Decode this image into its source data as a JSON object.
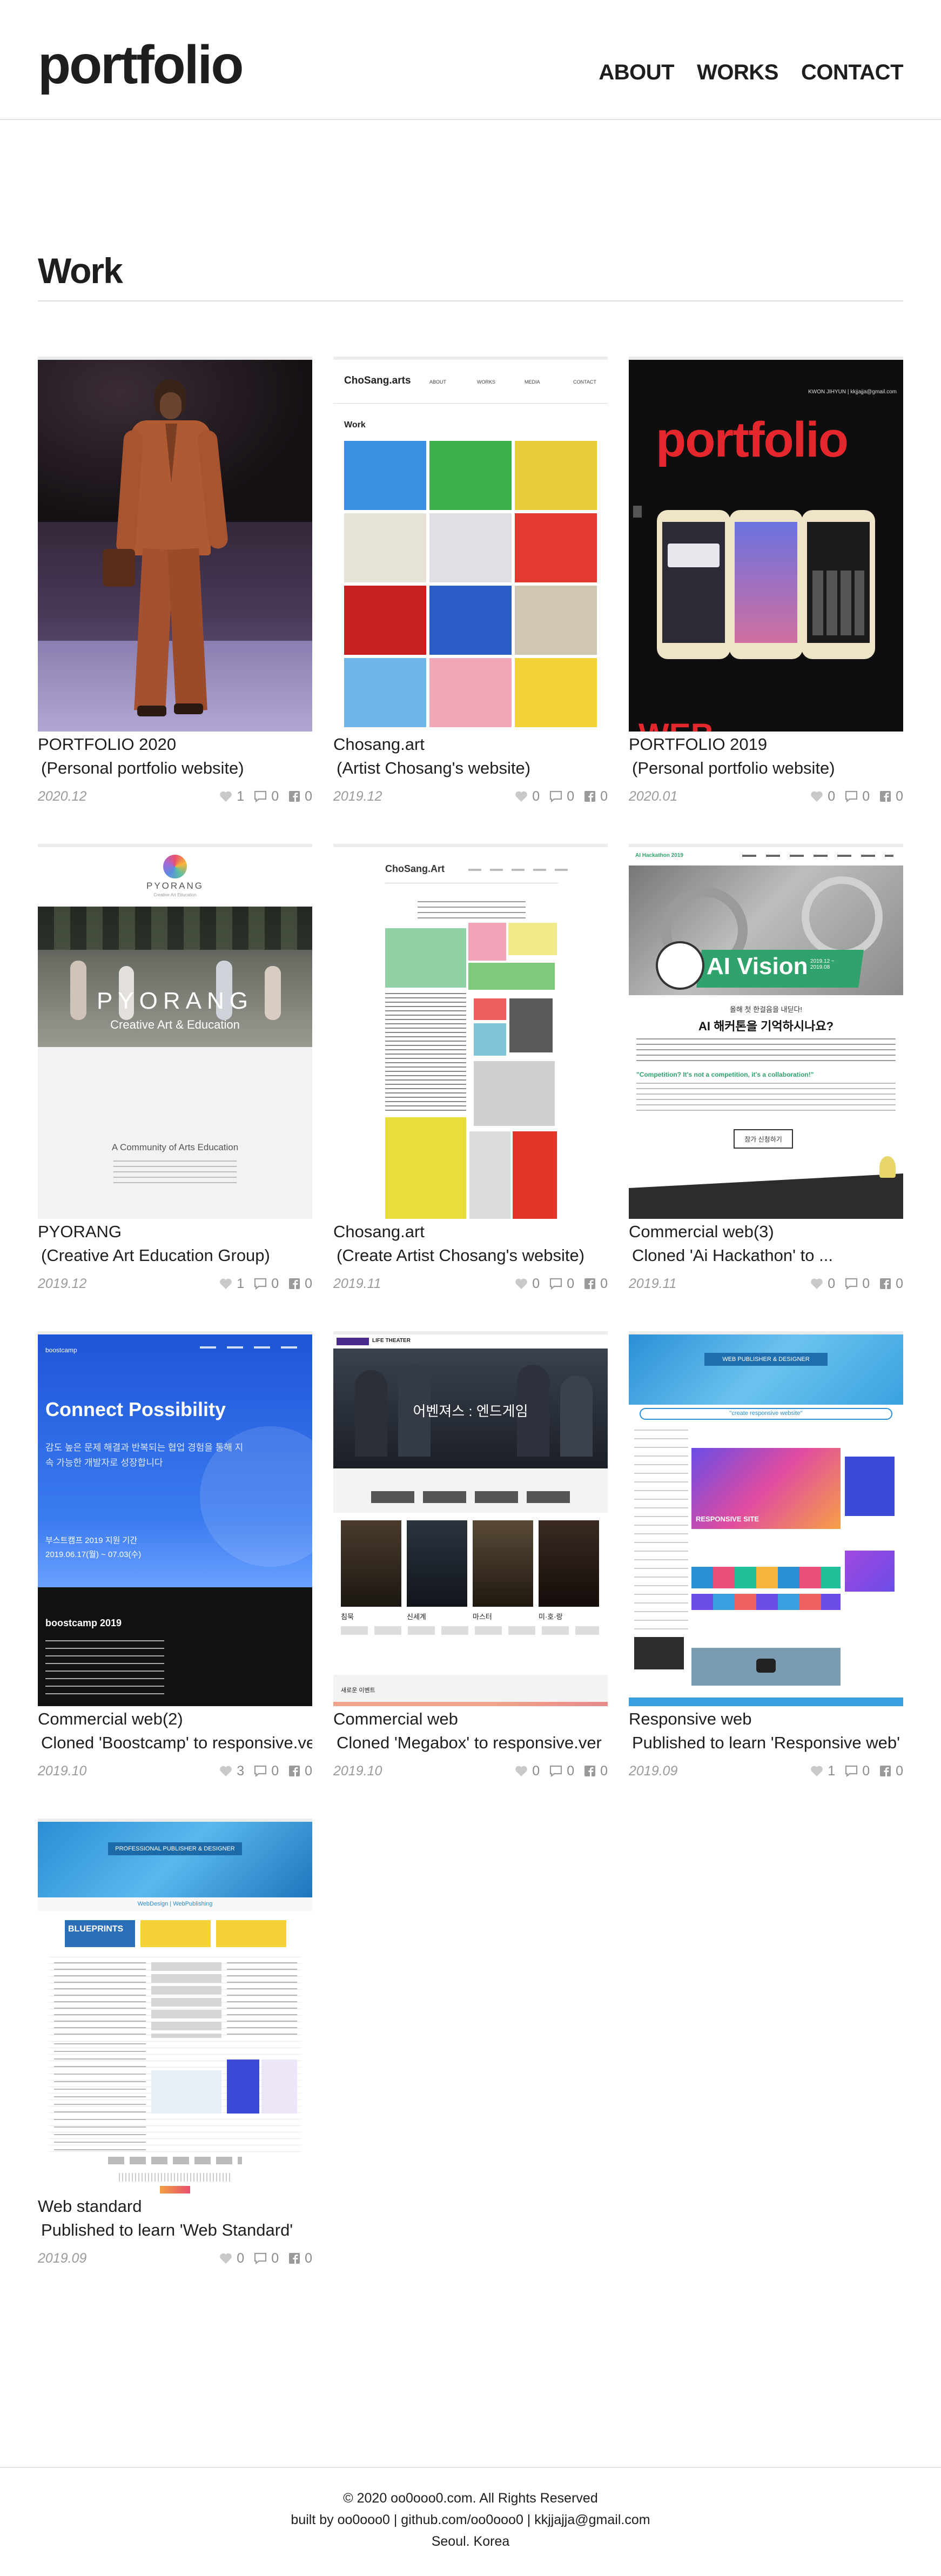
{
  "header": {
    "logo": "portfolio",
    "nav": [
      "ABOUT",
      "WORKS",
      "CONTACT"
    ]
  },
  "section": {
    "title": "Work"
  },
  "cards": [
    {
      "title": "PORTFOLIO 2020",
      "subtitle": "(Personal portfolio website)",
      "date": "2020.12",
      "likes": "1",
      "comments": "0",
      "shares": "0"
    },
    {
      "title": "Chosang.art",
      "subtitle": "(Artist Chosang's website)",
      "date": "2019.12",
      "likes": "0",
      "comments": "0",
      "shares": "0"
    },
    {
      "title": "PORTFOLIO 2019",
      "subtitle": "(Personal portfolio website)",
      "date": "2020.01",
      "likes": "0",
      "comments": "0",
      "shares": "0"
    },
    {
      "title": "PYORANG",
      "subtitle": "(Creative Art Education Group)",
      "date": "2019.12",
      "likes": "1",
      "comments": "0",
      "shares": "0"
    },
    {
      "title": "Chosang.art",
      "subtitle": "(Create Artist Chosang's website)",
      "date": "2019.11",
      "likes": "0",
      "comments": "0",
      "shares": "0"
    },
    {
      "title": "Commercial web(3)",
      "subtitle": "Cloned 'Ai Hackathon' to ...",
      "date": "2019.11",
      "likes": "0",
      "comments": "0",
      "shares": "0"
    },
    {
      "title": "Commercial web(2)",
      "subtitle": "Cloned 'Boostcamp' to responsive.ver",
      "date": "2019.10",
      "likes": "3",
      "comments": "0",
      "shares": "0"
    },
    {
      "title": "Commercial web",
      "subtitle": "Cloned 'Megabox' to responsive.ver",
      "date": "2019.10",
      "likes": "0",
      "comments": "0",
      "shares": "0"
    },
    {
      "title": "Responsive web",
      "subtitle": "Published to learn 'Responsive web'",
      "date": "2019.09",
      "likes": "1",
      "comments": "0",
      "shares": "0"
    },
    {
      "title": "Web standard",
      "subtitle": "Published to learn 'Web Standard'",
      "date": "2019.09",
      "likes": "0",
      "comments": "0",
      "shares": "0"
    }
  ],
  "thumbs": {
    "chosang1": {
      "brand": "ChoSang.arts",
      "nav": [
        "ABOUT",
        "WORKS",
        "MEDIA",
        "CONTACT"
      ],
      "heading": "Work"
    },
    "portfolio2019": {
      "header_text": "KWON JIHYUN | kkjjajja@gmail.com",
      "word": "portfolio",
      "bottom_word": "WEB"
    },
    "pyorang": {
      "logo": "PYORANG",
      "logo_sub": "Creative Art Education",
      "hero": "PYORANG",
      "hero_sub": "Creative Art & Education",
      "caption": "A Community of Arts Education"
    },
    "chosang2": {
      "brand": "ChoSang.Art"
    },
    "aihack": {
      "brand": "AI Hackathon 2019",
      "badge": "AI Vision",
      "badge_date": "2019.12 ~ 2019.08",
      "line1": "올해 첫 한걸음을 내딛다!",
      "line2": "AI 해커톤을 기억하시나요?",
      "quote": "\"Competition? It's not a competition, it's a collaboration!\"",
      "cta": "참가 신청하기"
    },
    "boostcamp": {
      "brand": "boostcamp",
      "headline": "Connect Possibility",
      "desc": "감도 높은 문제 해결과 반복되는 협업 경험을 통해 지속 가능한 개발자로 성장합니다",
      "period_label": "부스트캠프 2019 지원 기간",
      "period": "2019.06.17(월) ~ 07.03(수)",
      "foot_title": "boostcamp 2019"
    },
    "megabox": {
      "brand": "LIFE THEATER",
      "hero": "어벤져스 : 엔드게임",
      "movies": [
        "침묵",
        "신세계",
        "마스터",
        "미·호·랑"
      ],
      "section": "새로운 이벤트"
    },
    "responsive": {
      "banner": "WEB PUBLISHER & DESIGNER",
      "tagline": "\"create responsive website\"",
      "card": "RESPONSIVE SITE"
    },
    "webstandard": {
      "banner": "PROFESSIONAL PUBLISHER & DESIGNER",
      "tagline": "WebDesign | WebPublishing",
      "blueprint": "BLUEPRINTS"
    }
  },
  "footer": {
    "line1": "© 2020 oo0ooo0.com. All Rights Reserved",
    "line2": "built by oo0ooo0 | github.com/oo0ooo0 | kkjjajja@gmail.com",
    "line3": "Seoul. Korea"
  },
  "colors": {
    "text": "#1e1e1e",
    "meta": "#9b9b9b",
    "rule": "#e2e2e2",
    "portfolio_red": "#e4262d",
    "ai_green": "#2fa36b",
    "boost_blue": "#2f6ee6"
  }
}
